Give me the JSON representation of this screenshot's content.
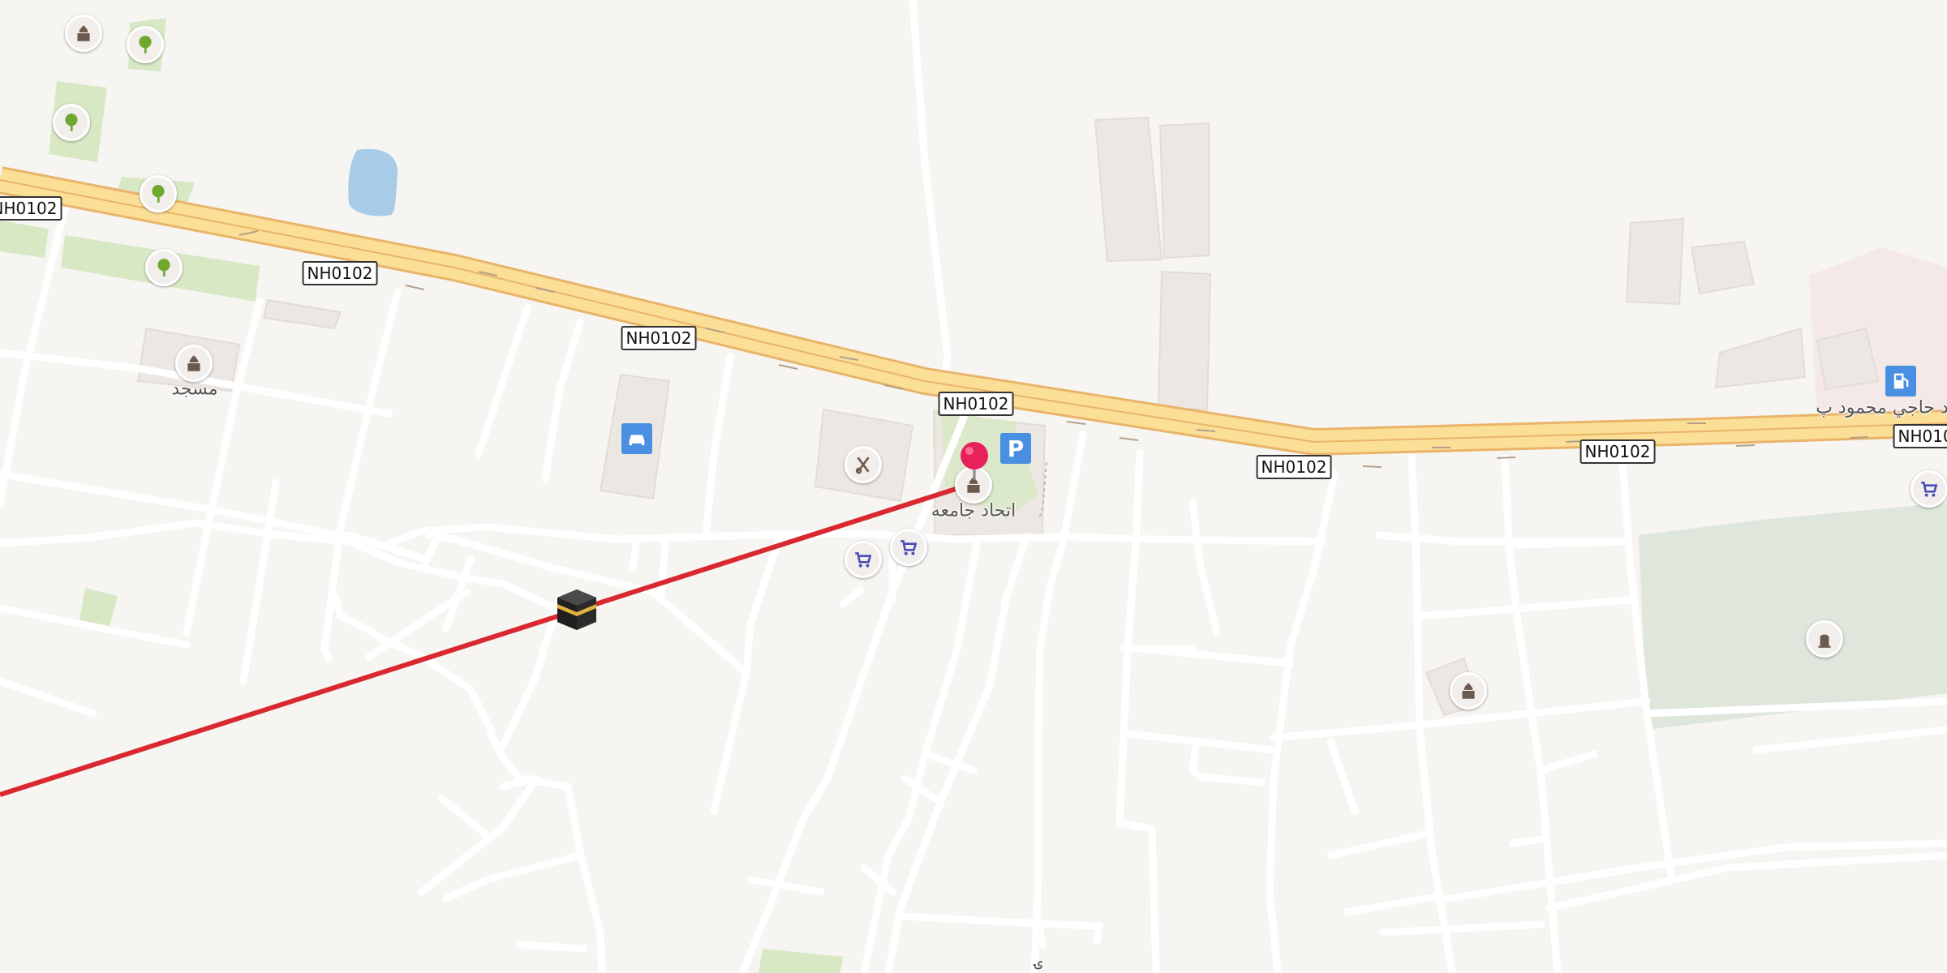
{
  "road_ref": "NH0102",
  "labels": {
    "masjid": "مسجد",
    "ittihad_mosque": "اتحاد جامعه",
    "haji_mahmood": "د حاجي محمود پ",
    "bottom_glyph": "ۍ"
  },
  "colors": {
    "background": "#f7f5f2",
    "primary_road_fill": "#fbdf96",
    "primary_road_casing": "#e9b469",
    "minor_road": "#ffffff",
    "park": "#d8e8c4",
    "water": "#a8cbe8",
    "building": "#ece7e2",
    "route_line": "#d9282f",
    "pin": "#e8205c",
    "info_square": "#4a90e2"
  },
  "icons": {
    "poi_mosque": "mosque-icon",
    "poi_park": "tree-icon",
    "poi_shop": "shopping-cart-icon",
    "poi_car": "car-icon",
    "poi_parking": "parking-icon",
    "poi_fuel": "fuel-pump-icon",
    "poi_cemetery": "grave-icon",
    "poi_hairdresser": "hairdresser-icon",
    "qibla": "kaaba-icon",
    "selected": "location-pin-icon"
  },
  "parking_letter": "P"
}
